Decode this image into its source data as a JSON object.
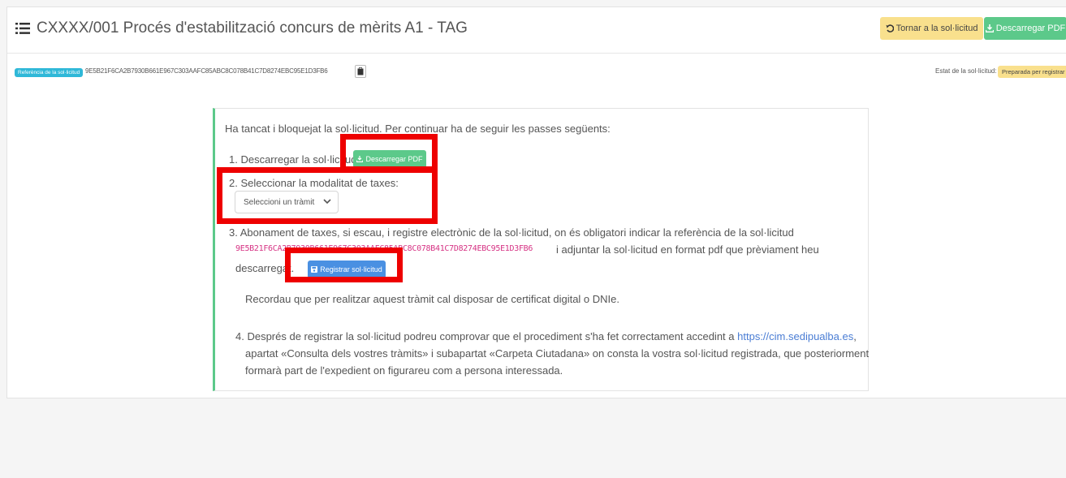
{
  "header": {
    "title": "CXXXX/001 Procés d'estabilització concurs de mèrits A1 - TAG",
    "back_label": "Tornar a la sol·licitud",
    "download_label": "Descarregar PDF"
  },
  "reference": {
    "badge_label": "Referència de la sol·licitud",
    "code": "9E5B21F6CA2B7930B661E967C303AAFC85ABC8C078B41C7D8274EBC95E1D3FB6"
  },
  "status": {
    "label": "Estat de la sol·licitud:",
    "value": "Preparada per registrar"
  },
  "instructions": {
    "intro": "Ha tancat i bloquejat la sol·licitud. Per continuar ha de seguir les passes següents:",
    "step1": "1. Descarregar la sol·licitud",
    "step1_button": "Descarregar PDF",
    "step2": "2. Seleccionar la modalitat de taxes:",
    "step2_select_value": "Seleccioni un tràmit",
    "step3_line1": "3. Abonament de taxes, si escau, i registre electrònic de la sol·licitud, on és obligatori indicar la referència de la sol·licitud",
    "step3_ref": "9E5B21F6CA2B7930B661E967C303AAFC85ABC8C078B41C7D8274EBC95E1D3FB6",
    "step3_line2_suffix": "i adjuntar la sol·licitud en format pdf que prèviament heu",
    "step3_line3": "descarregat.",
    "step3_button": "Registrar sol·licitud",
    "step3_note": "Recordau que per realitzar aquest tràmit cal disposar de certificat digital o DNIe.",
    "step4_line1_prefix": "4. Després de registrar la sol·licitud podreu comprovar que el procediment s'ha fet correctament accedint a",
    "step4_link": "https://cim.sedipualba.es",
    "step4_line2": "apartat «Consulta dels vostres tràmits» i subapartat «Carpeta Ciutadana» on consta la vostra sol·licitud registrada, que posteriorment",
    "step4_line3": "formarà part de l'expedient on figurareu com a persona interessada."
  },
  "icons": {
    "list": "list-icon",
    "back": "undo-icon",
    "download": "download-icon",
    "copy": "clipboard-icon",
    "register": "floppy-disk-icon",
    "chevron": "chevron-down-icon"
  },
  "colors": {
    "green": "#5cc98a",
    "yellow": "#f9e08d",
    "blue": "#4a90e2",
    "cyan": "#2fb8d8",
    "highlight_red": "#ee0000",
    "ref_pink": "#d63384"
  }
}
